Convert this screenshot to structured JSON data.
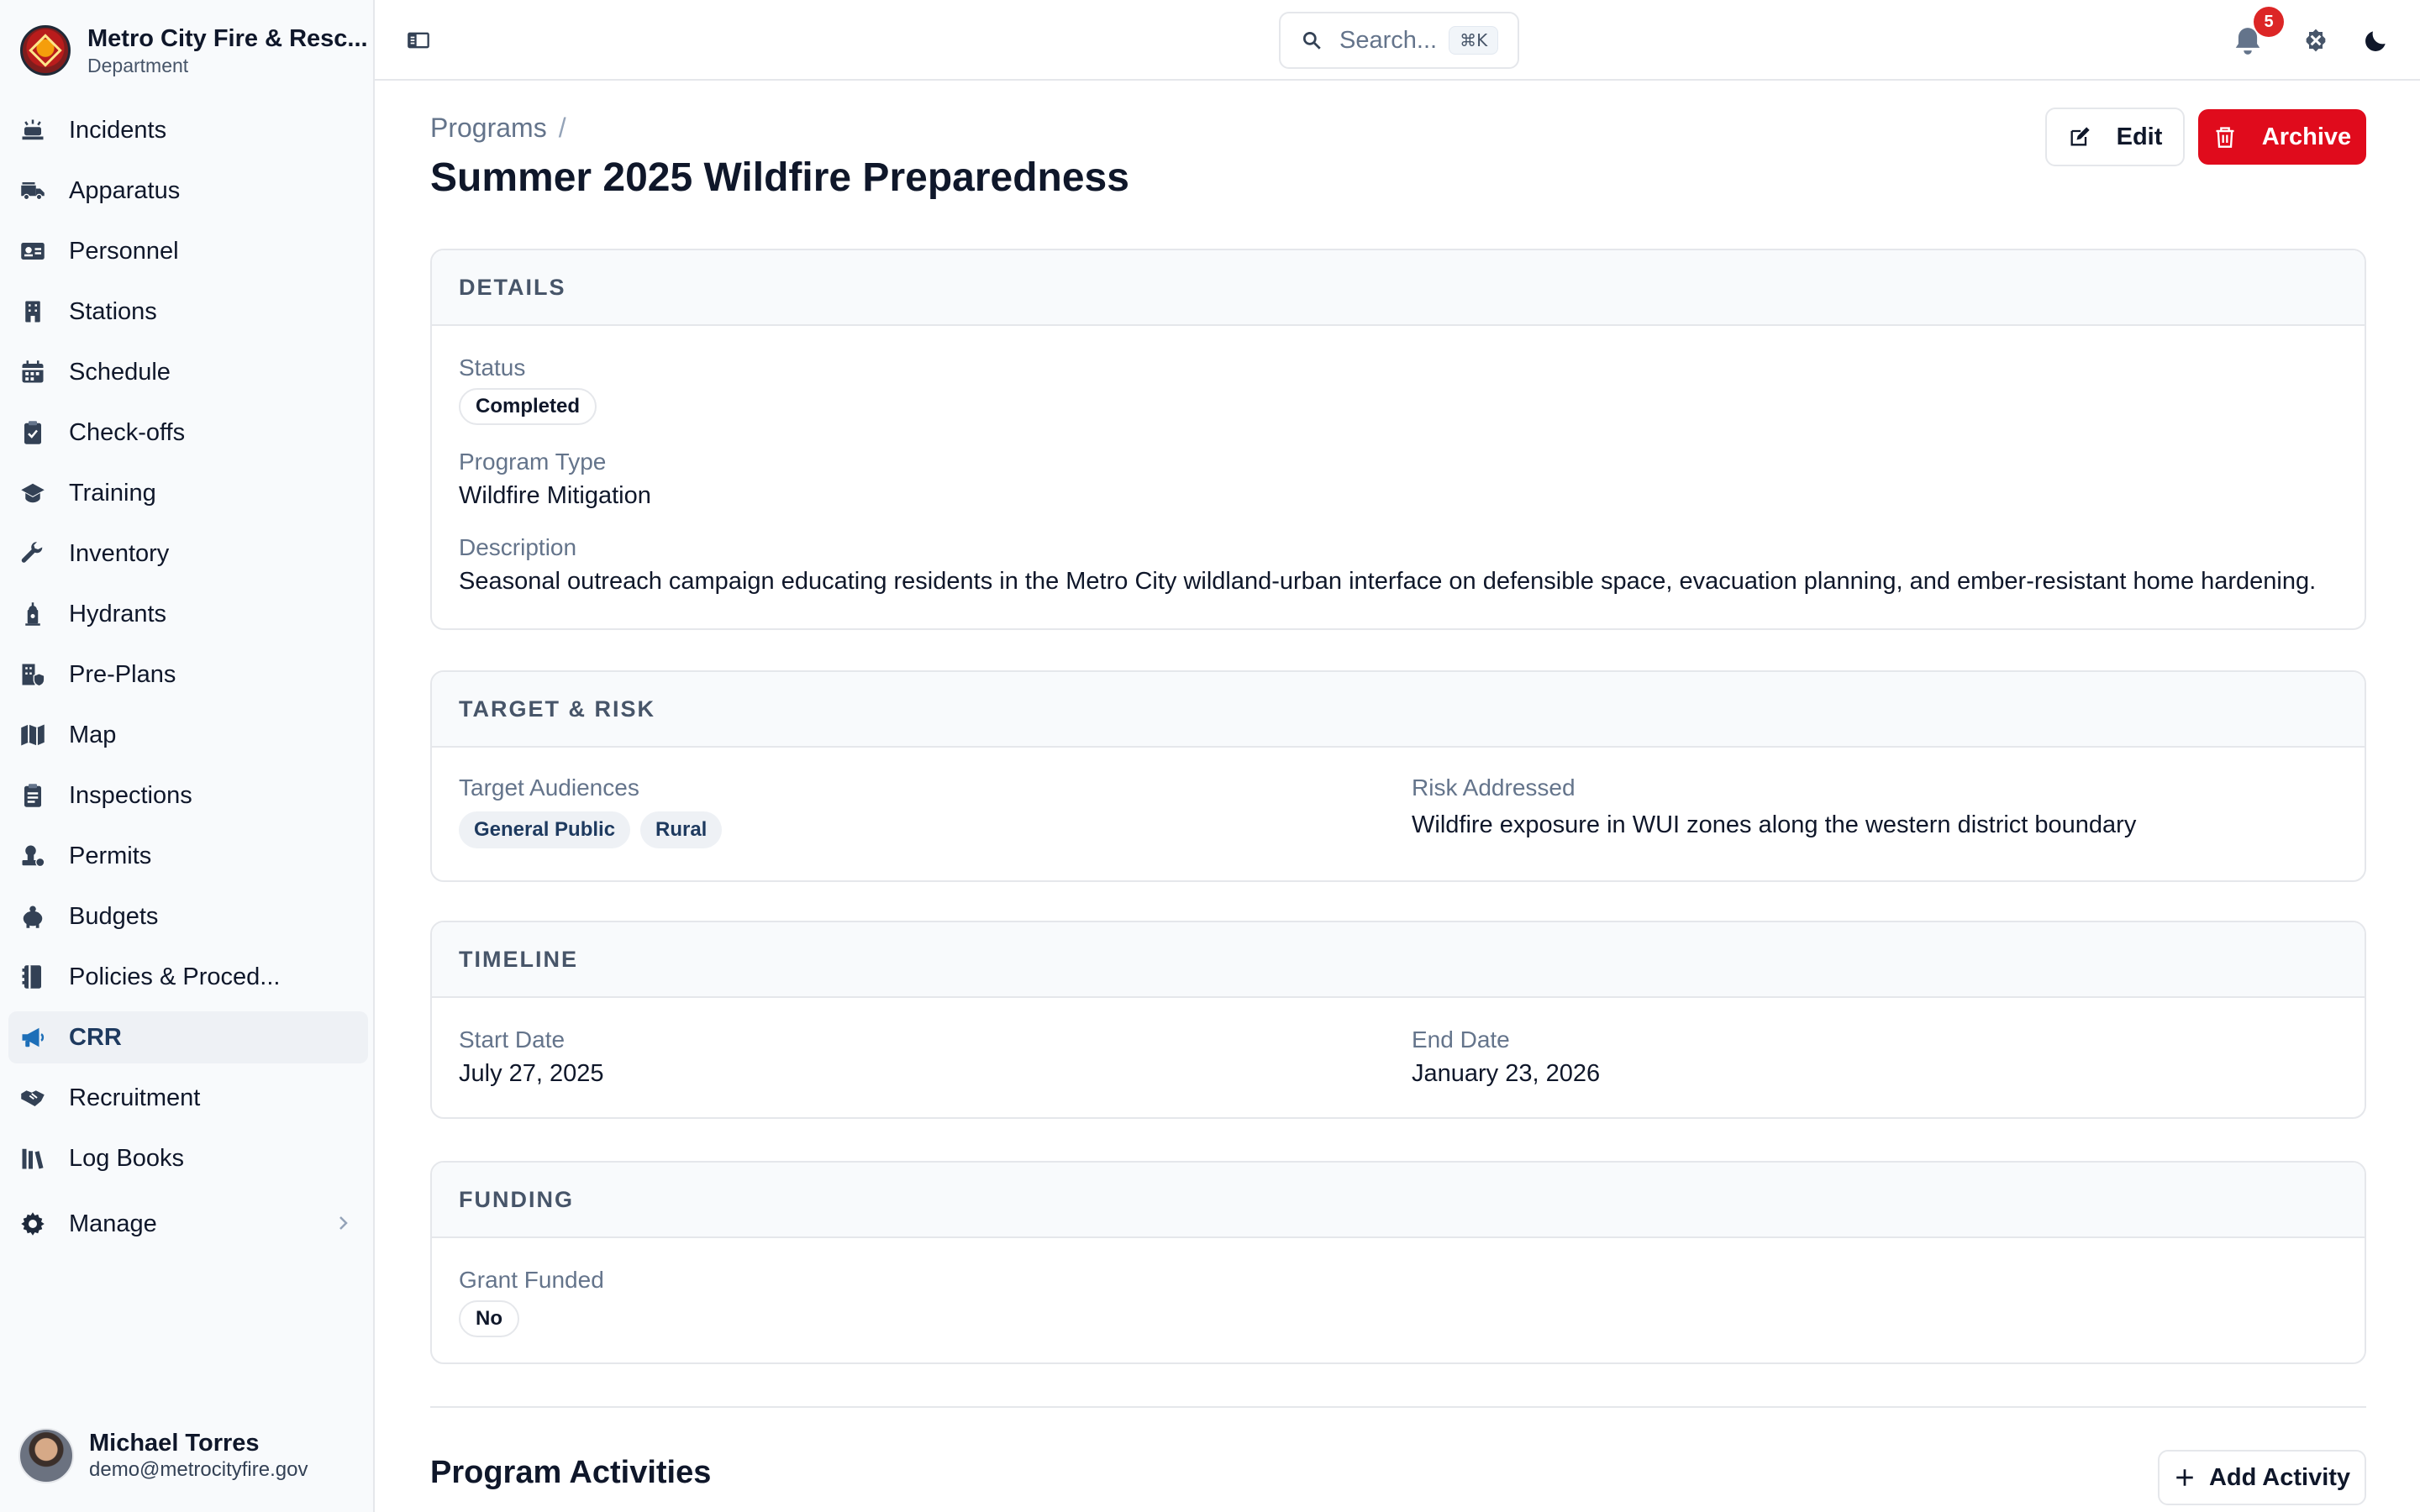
{
  "app": {
    "name": "Metro City Fire & Resc...",
    "subtitle": "Department"
  },
  "sidebar": {
    "items": [
      {
        "label": "Incidents",
        "icon": "siren-icon"
      },
      {
        "label": "Apparatus",
        "icon": "fire-truck-icon"
      },
      {
        "label": "Personnel",
        "icon": "id-card-icon"
      },
      {
        "label": "Stations",
        "icon": "building-icon"
      },
      {
        "label": "Schedule",
        "icon": "calendar-icon"
      },
      {
        "label": "Check-offs",
        "icon": "clipboard-check-icon"
      },
      {
        "label": "Training",
        "icon": "graduation-cap-icon"
      },
      {
        "label": "Inventory",
        "icon": "wrench-icon"
      },
      {
        "label": "Hydrants",
        "icon": "hydrant-icon"
      },
      {
        "label": "Pre-Plans",
        "icon": "building-shield-icon"
      },
      {
        "label": "Map",
        "icon": "map-icon"
      },
      {
        "label": "Inspections",
        "icon": "clipboard-list-icon"
      },
      {
        "label": "Permits",
        "icon": "stamp-icon"
      },
      {
        "label": "Budgets",
        "icon": "piggy-bank-icon"
      },
      {
        "label": "Policies & Proced...",
        "icon": "book-icon"
      },
      {
        "label": "CRR",
        "icon": "megaphone-icon",
        "active": true
      },
      {
        "label": "Recruitment",
        "icon": "handshake-icon"
      },
      {
        "label": "Log Books",
        "icon": "books-icon"
      }
    ],
    "manage_label": "Manage"
  },
  "user": {
    "name": "Michael Torres",
    "email": "demo@metrocityfire.gov"
  },
  "topbar": {
    "search_placeholder": "Search...",
    "search_shortcut": "⌘K",
    "notification_count": "5"
  },
  "page": {
    "breadcrumb": "Programs",
    "breadcrumb_sep": "/",
    "title": "Summer 2025 Wildfire Preparedness",
    "edit_label": "Edit",
    "archive_label": "Archive"
  },
  "details": {
    "heading": "DETAILS",
    "status_label": "Status",
    "status_value": "Completed",
    "type_label": "Program Type",
    "type_value": "Wildfire Mitigation",
    "description_label": "Description",
    "description_value": "Seasonal outreach campaign educating residents in the Metro City wildland-urban interface on defensible space, evacuation planning, and ember-resistant home hardening."
  },
  "target": {
    "heading": "TARGET & RISK",
    "audiences_label": "Target Audiences",
    "audiences": [
      "General Public",
      "Rural"
    ],
    "risk_label": "Risk Addressed",
    "risk_value": "Wildfire exposure in WUI zones along the western district boundary"
  },
  "timeline": {
    "heading": "TIMELINE",
    "start_label": "Start Date",
    "start_value": "July 27, 2025",
    "end_label": "End Date",
    "end_value": "January 23, 2026"
  },
  "funding": {
    "heading": "FUNDING",
    "grant_label": "Grant Funded",
    "grant_value": "No"
  },
  "activities": {
    "title": "Program Activities",
    "add_label": "Add Activity"
  }
}
